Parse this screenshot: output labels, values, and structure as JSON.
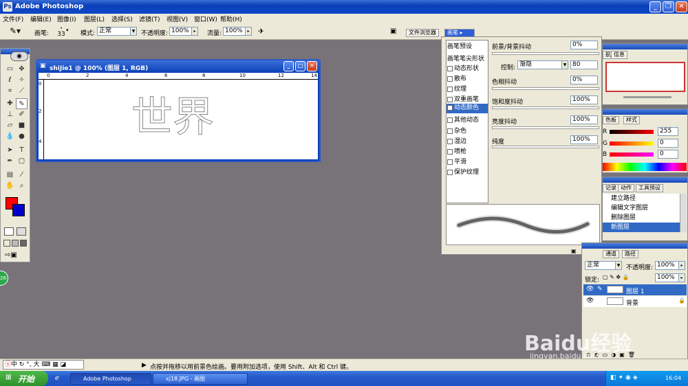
{
  "app_title": "Adobe Photoshop",
  "menu": [
    "文件(F)",
    "编辑(E)",
    "图像(I)",
    "图层(L)",
    "选择(S)",
    "滤镜(T)",
    "视图(V)",
    "窗口(W)",
    "帮助(H)"
  ],
  "options": {
    "brush_label": "画笔:",
    "brush_size": "33",
    "mode_label": "模式:",
    "mode_value": "正常",
    "opacity_label": "不透明度:",
    "opacity_value": "100%",
    "flow_label": "流量:",
    "flow_value": "100%"
  },
  "well_tabs": [
    "文件浏览器",
    "画笔"
  ],
  "colors": {
    "foreground": "#ff0000",
    "background": "#0000cc",
    "xp_blue": "#0a3fb8"
  },
  "document": {
    "title": "shiJie1 @ 100% (图层 1, RGB)",
    "ruler_ticks": [
      "0",
      "2",
      "4",
      "6",
      "8",
      "10",
      "12",
      "14"
    ],
    "ruler_v_ticks": [
      "0",
      "2",
      "4"
    ],
    "canvas_text": "世界"
  },
  "brushes": {
    "presets_label": "画笔预设",
    "tip_label": "画笔笔尖形状",
    "options": [
      {
        "label": "动态形状",
        "checked": false
      },
      {
        "label": "散布",
        "checked": false
      },
      {
        "label": "纹理",
        "checked": false
      },
      {
        "label": "双重画笔",
        "checked": false
      },
      {
        "label": "动态颜色",
        "checked": true
      },
      {
        "label": "其他动态",
        "checked": false
      },
      {
        "label": "杂色",
        "checked": false
      },
      {
        "label": "湿边",
        "checked": false
      },
      {
        "label": "喷枪",
        "checked": false
      },
      {
        "label": "平滑",
        "checked": false
      },
      {
        "label": "保护纹理",
        "checked": false
      }
    ],
    "fg_bg_jitter_label": "前景/背景抖动",
    "fg_bg_jitter_value": "0%",
    "control_label": "控制:",
    "control_value": "渐隐",
    "control_steps": "80",
    "hue_label": "色相抖动",
    "hue_value": "0%",
    "saturation_label": "饱和度抖动",
    "saturation_value": "100%",
    "brightness_label": "亮度抖动",
    "brightness_value": "100%",
    "purity_label": "纯度",
    "purity_value": "100%"
  },
  "navigator": {
    "tabs": [
      "航",
      "信息"
    ]
  },
  "color_palette": {
    "tabs": [
      "色板",
      "样式"
    ],
    "r_label": "R",
    "r_value": "255",
    "g_label": "G",
    "g_value": "0",
    "b_label": "B",
    "b_value": "0"
  },
  "history": {
    "tabs": [
      "记录",
      "动作",
      "工具预设"
    ],
    "items": [
      "建立路径",
      "编辑文字图层",
      "删除图层",
      "新图层"
    ]
  },
  "layers": {
    "tabs": [
      "通道",
      "路径"
    ],
    "blend_mode": "正常",
    "opacity_label": "不透明度:",
    "opacity_value": "100%",
    "lock_label": "锁定:",
    "fill_value": "100%",
    "items": [
      {
        "name": "图层 1",
        "selected": true
      },
      {
        "name": "背景",
        "selected": false
      }
    ]
  },
  "status": {
    "message": "点按并拖移以用前景色绘画。要用附加选项，使用 Shift、Alt 和 Ctrl 键。",
    "ime": "中"
  },
  "taskbar": {
    "start": "开始",
    "items": [
      "Adobe Photoshop",
      "xj18.JPG - 画图"
    ],
    "clock": "16:04"
  },
  "watermark": {
    "logo": "Baidu经验",
    "url": "jingyan.baidu.com"
  }
}
